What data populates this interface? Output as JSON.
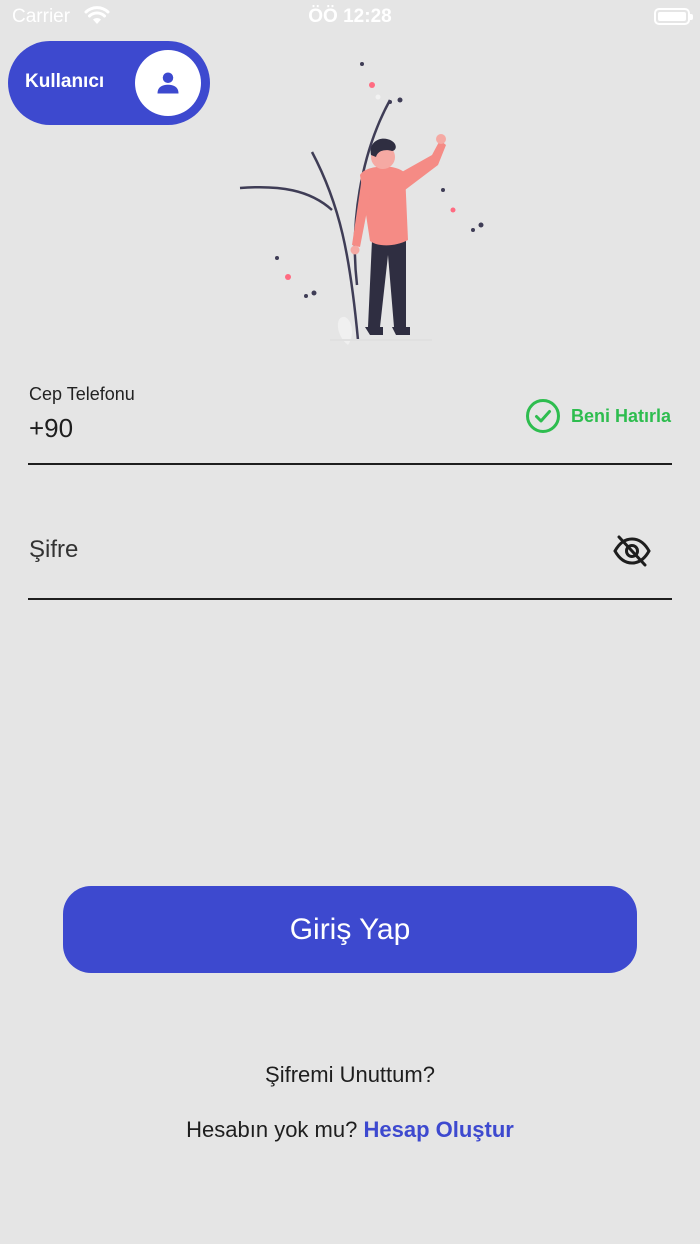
{
  "status_bar": {
    "carrier": "Carrier",
    "time": "ÖÖ 12:28"
  },
  "user_toggle": {
    "label": "Kullanıcı",
    "icon": "person-icon"
  },
  "form": {
    "phone_label": "Cep Telefonu",
    "phone_value": "+90",
    "remember_label": "Beni Hatırla",
    "password_placeholder": "Şifre"
  },
  "actions": {
    "login_label": "Giriş Yap",
    "forgot_label": "Şifremi Unuttum?",
    "no_account_text": "Hesabın yok mu?",
    "create_account_label": "Hesap Oluştur"
  },
  "colors": {
    "accent": "#3d49cf",
    "success": "#2ebd4f",
    "background": "#e5e5e5"
  }
}
